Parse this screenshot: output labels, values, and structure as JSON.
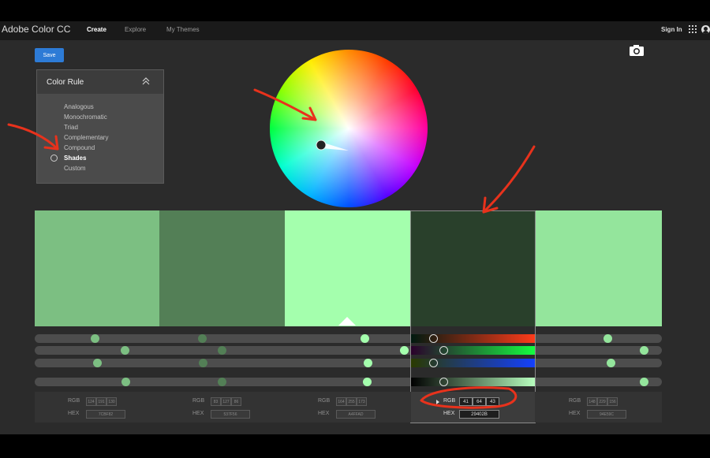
{
  "app": {
    "brand": "Adobe Color CC",
    "nav": [
      "Create",
      "Explore",
      "My Themes"
    ],
    "sign_in": "Sign In"
  },
  "toolbar": {
    "save_label": "Save"
  },
  "color_rule": {
    "title": "Color Rule",
    "options": [
      "Analogous",
      "Monochromatic",
      "Triad",
      "Complementary",
      "Compound",
      "Shades",
      "Custom"
    ],
    "selected": "Shades"
  },
  "swatches": [
    {
      "hex": "#7CBF82",
      "rgb": [
        "124",
        "191",
        "130"
      ],
      "hex_label": "7CBF82"
    },
    {
      "hex": "#537F56",
      "rgb": [
        "83",
        "127",
        "86"
      ],
      "hex_label": "537F56"
    },
    {
      "hex": "#A4FFAD",
      "rgb": [
        "164",
        "255",
        "173"
      ],
      "hex_label": "A4FFAD"
    },
    {
      "hex": "#29402B",
      "rgb": [
        "41",
        "64",
        "43"
      ],
      "hex_label": "29402B"
    },
    {
      "hex": "#94E59C",
      "rgb": [
        "148",
        "229",
        "156"
      ],
      "hex_label": "94E59C"
    }
  ],
  "active_swatch": 3,
  "labels": {
    "rgb": "RGB",
    "hex": "HEX"
  },
  "colors": {
    "app_bg": "#2b2b2b",
    "accent": "#2d7bd6",
    "annotation": "#e8321c"
  },
  "icons": {
    "camera": "camera-icon",
    "apps": "app-grid-icon",
    "collapse": "chevron-up-icon",
    "disclosure": "triangle-right-icon"
  }
}
